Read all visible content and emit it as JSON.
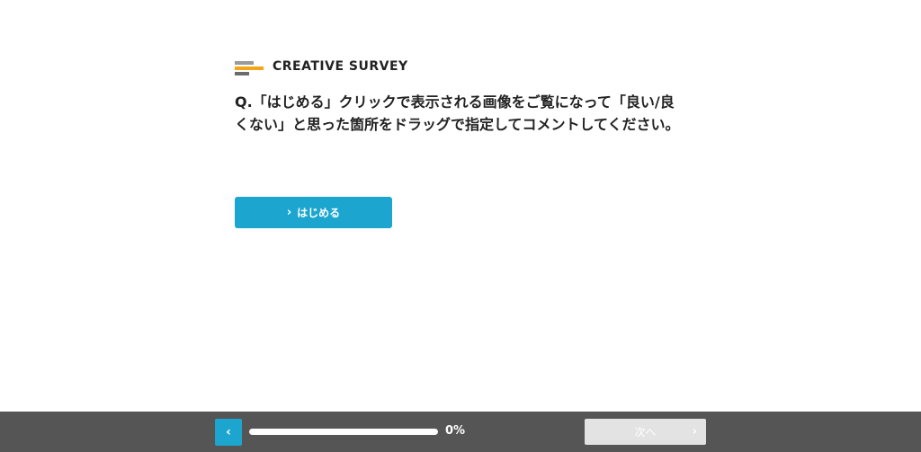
{
  "header": {
    "brand_name": "CREATIVE SURVEY",
    "logo_colors": [
      "#9a9a9a",
      "#f3a417",
      "#6c6c6c"
    ]
  },
  "question": {
    "text": "Q.「はじめる」クリックで表示される画像をご覧になって「良い/良くない」と思った箇所をドラッグで指定してコメントしてください。"
  },
  "start_button": {
    "icon": "chevron-right-icon",
    "label": "はじめる"
  },
  "footer": {
    "back_icon": "chevron-left-icon",
    "progress_percent": 0,
    "progress_label": "0%",
    "next_label": "次へ",
    "next_icon": "chevron-right-icon"
  },
  "colors": {
    "accent": "#1ca6cf",
    "footer_bg": "#555555",
    "disabled_button": "#e3e3e3",
    "text": "#222222"
  }
}
